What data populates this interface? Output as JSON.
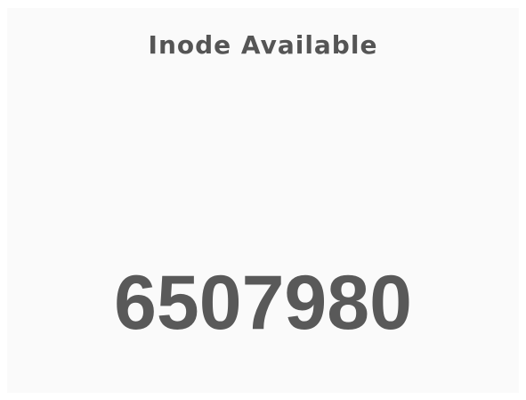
{
  "panel": {
    "title": "Inode Available",
    "value": "6507980"
  },
  "colors": {
    "panel_background": "#fafafa",
    "title_text": "#555555",
    "value_text": "#595959"
  }
}
